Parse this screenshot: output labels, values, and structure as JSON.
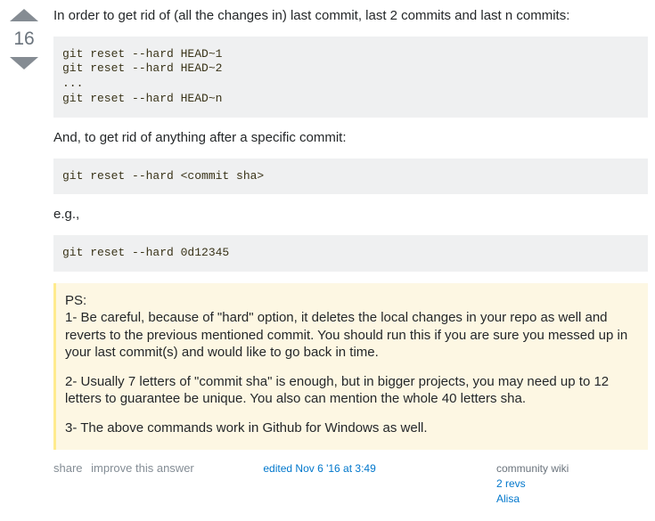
{
  "vote": {
    "count": "16"
  },
  "body": {
    "intro": "In order to get rid of (all the changes in) last commit, last 2 commits and last n commits:",
    "code1": "git reset --hard HEAD~1\ngit reset --hard HEAD~2\n...\ngit reset --hard HEAD~n",
    "after_specific": "And, to get rid of anything after a specific commit:",
    "code2": "git reset --hard <commit sha>",
    "eg": "e.g.,",
    "code3": "git reset --hard 0d12345",
    "ps_header": "PS:",
    "ps1": "1- Be careful, because of \"hard\" option, it deletes the local changes in your repo as well and reverts to the previous mentioned commit. You should run this if you are sure you messed up in your last commit(s) and would like to go back in time.",
    "ps2": "2- Usually 7 letters of \"commit sha\" is enough, but in bigger projects, you may need up to 12 letters to guarantee be unique. You also can mention the whole 40 letters sha.",
    "ps3": "3- The above commands work in Github for Windows as well."
  },
  "menu": {
    "share": "share",
    "improve": "improve this answer"
  },
  "edited": {
    "text": "edited Nov 6 '16 at 3:49"
  },
  "user": {
    "wiki": "community wiki",
    "revs": "2 revs",
    "name": "Alisa"
  }
}
